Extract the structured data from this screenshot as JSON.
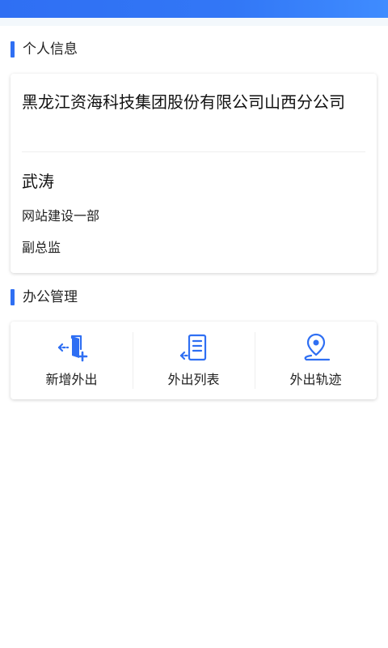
{
  "profile_section": {
    "title": "个人信息",
    "company": "黑龙江资海科技集团股份有限公司山西分公司",
    "name": "武涛",
    "department": "网站建设一部",
    "position": "副总监"
  },
  "office_section": {
    "title": "办公管理",
    "items": [
      {
        "label": "新增外出",
        "icon": "add-outing-icon"
      },
      {
        "label": "外出列表",
        "icon": "outing-list-icon"
      },
      {
        "label": "外出轨迹",
        "icon": "location-track-icon"
      }
    ]
  },
  "colors": {
    "accent": "#2f6ff3",
    "text": "#222222",
    "divider": "#eeeeee"
  }
}
